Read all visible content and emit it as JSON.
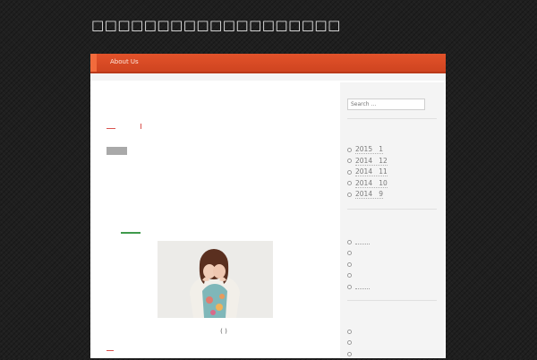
{
  "site": {
    "title": "□□□□□□□□□□□□□□□□□□□"
  },
  "nav": {
    "items": [
      {
        "label": "About Us"
      }
    ]
  },
  "search": {
    "placeholder": "Search ..."
  },
  "archives": [
    {
      "year": "2015",
      "month": "1"
    },
    {
      "year": "2014",
      "month": "12"
    },
    {
      "year": "2014",
      "month": "11"
    },
    {
      "year": "2014",
      "month": "10"
    },
    {
      "year": "2014",
      "month": "9"
    }
  ],
  "post": {
    "image_caption": "( )"
  },
  "colors": {
    "nav_bar": "#d84b25",
    "accent_red": "#d9534f",
    "accent_green": "#3f9a4c",
    "background": "#1f1f1f"
  }
}
